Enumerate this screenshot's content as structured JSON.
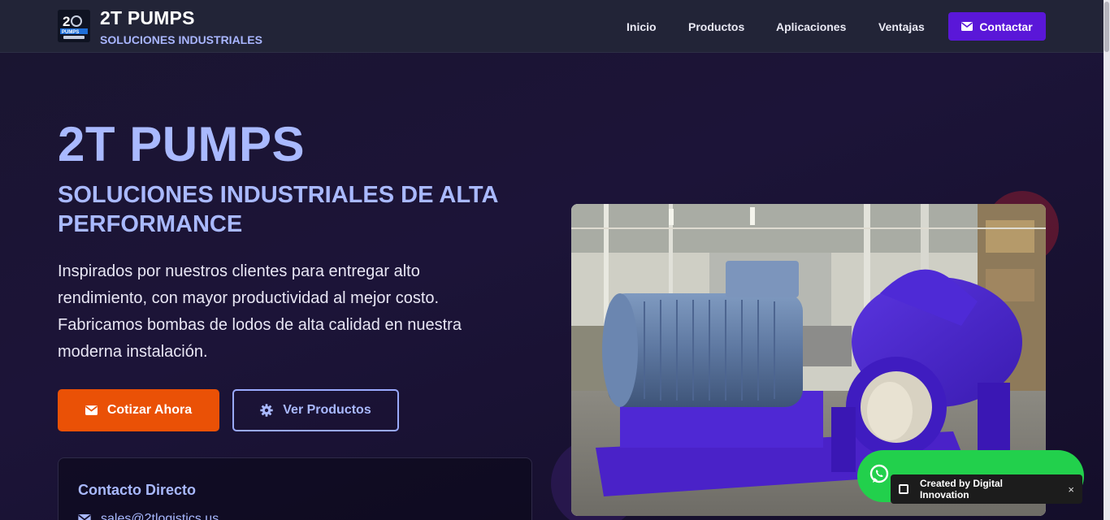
{
  "header": {
    "brand_name": "2T PUMPS",
    "brand_tagline": "SOLUCIONES INDUSTRIALES",
    "logo_text": "2T PUMPS SERVICE",
    "nav": [
      {
        "label": "Inicio"
      },
      {
        "label": "Productos"
      },
      {
        "label": "Aplicaciones"
      },
      {
        "label": "Ventajas"
      }
    ],
    "contact_label": "Contactar"
  },
  "hero": {
    "title": "2T PUMPS",
    "subtitle": "SOLUCIONES INDUSTRIALES DE ALTA PERFORMANCE",
    "description": "Inspirados por nuestros clientes para entregar alto rendimiento, con mayor productividad al mejor costo. Fabricamos bombas de lodos de alta calidad en nuestra moderna instalación.",
    "primary_button": "Cotizar Ahora",
    "secondary_button": "Ver Productos",
    "image_alt": "industrial split-case pump with electric motor"
  },
  "contact_card": {
    "title": "Contacto Directo",
    "email": "sales@2tlogistics.us"
  },
  "widgets": {
    "credit_text": "Created by Digital Innovation",
    "close_symbol": "×"
  },
  "colors": {
    "accent_purple": "#5a17d8",
    "accent_orange": "#ea5106",
    "heading_blue": "#a9b9ff",
    "whatsapp_green": "#22d04c"
  }
}
